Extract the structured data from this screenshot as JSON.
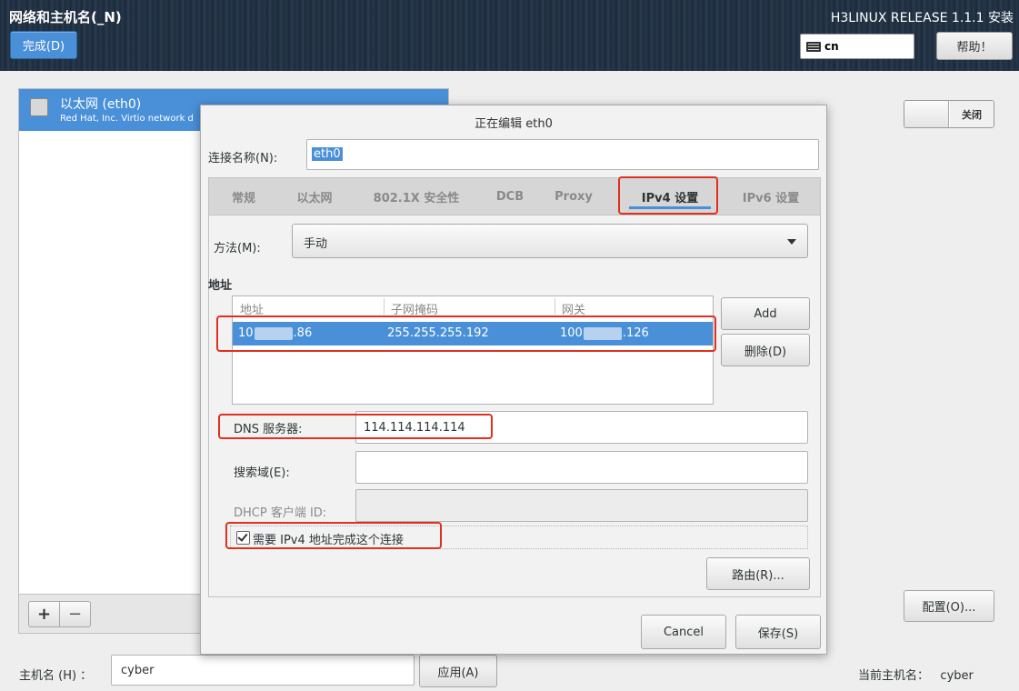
{
  "banner": {
    "title": "网络和主机名(_N)",
    "done_label": "完成(D)",
    "release": "H3LINUX RELEASE 1.1.1 安装",
    "keyboard_layout": "cn",
    "help_label": "帮助！"
  },
  "connections": {
    "items": [
      {
        "name": "以太网 (eth0)",
        "description": "Red Hat, Inc. Virtio network d",
        "icon": "ethernet-icon"
      }
    ],
    "add_label": "+",
    "remove_label": "−"
  },
  "device": {
    "toggle_label": "关闭",
    "config_label": "配置(O)..."
  },
  "hostname": {
    "label": "主机名 (H) ：",
    "value": "cyber",
    "apply_label": "应用(A)",
    "current_label": "当前主机名：",
    "current_value": "cyber"
  },
  "dialog": {
    "title": "正在编辑 eth0",
    "connection_name_label": "连接名称(N):",
    "connection_name": "eth0",
    "tabs": [
      {
        "label": "常规"
      },
      {
        "label": "以太网"
      },
      {
        "label": "802.1X 安全性"
      },
      {
        "label": "DCB"
      },
      {
        "label": "Proxy"
      },
      {
        "label": "IPv4 设置"
      },
      {
        "label": "IPv6 设置"
      }
    ],
    "active_tab": "IPv4 设置",
    "method_label": "方法(M):",
    "method_value": "手动",
    "addresses_heading": "地址",
    "columns": [
      "地址",
      "子网掩码",
      "网关"
    ],
    "address_row": {
      "address_start": "10",
      "address_end": ".86",
      "netmask": "255.255.255.192",
      "gateway_start": "100",
      "gateway_end": ".126"
    },
    "add_label": "Add",
    "delete_label": "删除(D)",
    "dns_label": "DNS 服务器:",
    "dns_value": "114.114.114.114",
    "search_label": "搜索域(E):",
    "search_value": "",
    "dhcp_label": "DHCP 客户端 ID:",
    "dhcp_value": "",
    "require_ipv4_label": "需要 IPv4 地址完成这个连接",
    "require_ipv4_checked": true,
    "routes_label": "路由(R)...",
    "cancel_label": "Cancel",
    "save_label": "保存(S)"
  },
  "colors": {
    "accent": "#4a90d9",
    "highlight_annotation": "#e0301e"
  }
}
